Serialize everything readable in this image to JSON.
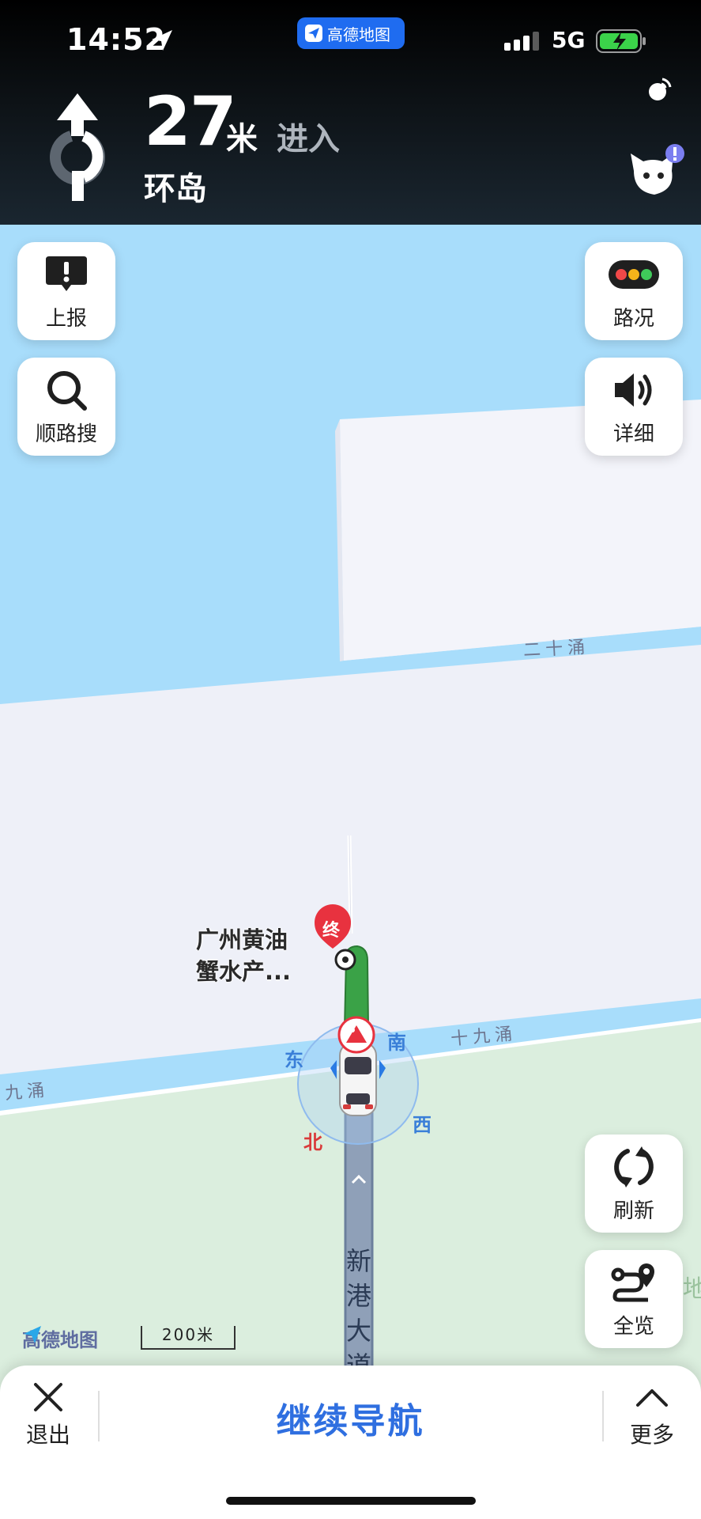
{
  "status_bar": {
    "time": "14:52",
    "app_name": "高德地图",
    "network": "5G"
  },
  "navigation": {
    "distance": "27",
    "unit": "米",
    "action": "进入",
    "target": "环岛"
  },
  "left_buttons": {
    "report": "上报",
    "search_along": "顺路搜"
  },
  "right_buttons": {
    "traffic": "路况",
    "detail": "详细",
    "refresh": "刷新",
    "overview": "全览"
  },
  "map": {
    "canal_top": "二十涌",
    "canal_bottom_right": "十九涌",
    "canal_bottom_left": "九涌",
    "poi_name_line1": "广州黄油",
    "poi_name_line2": "蟹水产...",
    "destination_marker": "终",
    "road_name": "新港大道",
    "edge_text": "地",
    "compass": {
      "east": "东",
      "south": "南",
      "west": "西",
      "north": "北"
    },
    "brand": "高德地图",
    "scale": "200米"
  },
  "bottom_bar": {
    "exit": "退出",
    "continue": "继续导航",
    "more": "更多"
  },
  "colors": {
    "water": "#a6dcfb",
    "land": "#eef0f8",
    "park": "#dbeede",
    "route_green": "#3aa247",
    "accent_blue": "#2f6fe0",
    "destination_red": "#e8323f"
  }
}
